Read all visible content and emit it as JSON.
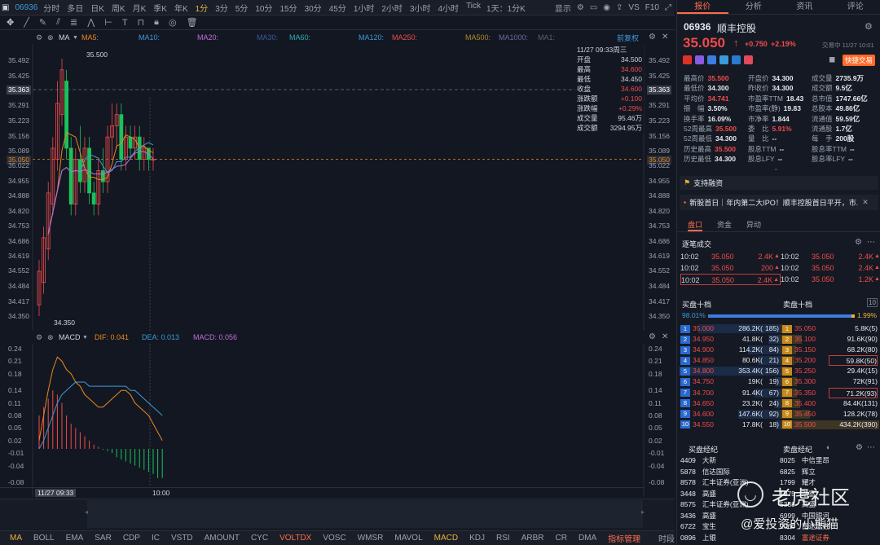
{
  "topbar": {
    "symbol": "06936",
    "periods": [
      "分时",
      "多日",
      "日K",
      "周K",
      "月K",
      "季K",
      "年K",
      "1分",
      "3分",
      "5分",
      "10分",
      "15分",
      "30分",
      "45分",
      "1小时",
      "2小时",
      "3小时",
      "4小时",
      "Tick"
    ],
    "selected": "1分",
    "compare": "1天：1分K",
    "display": "显示",
    "vs": "VS",
    "f10": "F10"
  },
  "legend": {
    "ma_name": "MA",
    "ma5": "MA5:",
    "ma10": "MA10:",
    "ma20": "MA20:",
    "ma30": "MA30:",
    "ma60": "MA60:",
    "ma120": "MA120:",
    "ma250": "MA250:",
    "ma500": "MA500:",
    "ma1000": "MA1000:",
    "ma_more": "MA1:",
    "adjust": "前复权",
    "macd_name": "MACD",
    "dif": "DIF: 0.041",
    "dea": "DEA: 0.013",
    "macd": "MACD: 0.056"
  },
  "chart": {
    "price_ticks": [
      "35.492",
      "35.425",
      "35.363",
      "35.291",
      "35.223",
      "35.156",
      "35.089",
      "35.050",
      "35.022",
      "34.955",
      "34.888",
      "34.820",
      "34.753",
      "34.686",
      "34.619",
      "34.552",
      "34.484",
      "34.417",
      "34.350"
    ],
    "high_label": "35.500",
    "low_label": "34.350",
    "macd_ticks": [
      "0.24",
      "0.21",
      "0.18",
      "0.14",
      "0.11",
      "0.08",
      "0.05",
      "0.02",
      "-0.01",
      "-0.04",
      "-0.08"
    ],
    "time_start": "11/27 09:33",
    "time_mid": "10:00",
    "ohlc": {
      "date": "11/27 09:33周三",
      "rows": [
        {
          "k": "开盘",
          "v": "34.500"
        },
        {
          "k": "最高",
          "v": "34.600"
        },
        {
          "k": "最低",
          "v": "34.450"
        },
        {
          "k": "收盘",
          "v": "34.600"
        },
        {
          "k": "涨跌额",
          "v": "+0.100"
        },
        {
          "k": "涨跌幅",
          "v": "+0.29%"
        },
        {
          "k": "成交量",
          "v": "95.46万"
        },
        {
          "k": "成交额",
          "v": "3294.95万"
        }
      ]
    },
    "colors": {
      "up": "#f04b4b",
      "down": "#19c25b",
      "ma5": "#e8891c",
      "ma10": "#3b9bd8",
      "ma20": "#c070d8"
    }
  },
  "bottombar": {
    "items": [
      "MA",
      "BOLL",
      "EMA",
      "SAR",
      "CDP",
      "IC",
      "VSTD",
      "AMOUNT",
      "CYC",
      "VOLTDX",
      "VOSC",
      "WMSR",
      "MAVOL",
      "MACD",
      "KDJ",
      "RSI",
      "ARBR",
      "CR",
      "DMA",
      "指标管理",
      "时段"
    ],
    "selected": [
      "MA",
      "MACD"
    ]
  },
  "quote": {
    "tabs": [
      "报价",
      "分析",
      "资讯",
      "评论"
    ],
    "code": "06936",
    "name": "顺丰控股",
    "price": "35.050",
    "change": "+0.750",
    "pct": "+2.19%",
    "status": "交易中 11/27 10:01",
    "trade_btn": "快捷交易",
    "stats": [
      [
        [
          "最高价",
          "35.500"
        ],
        [
          "开盘价",
          "34.300"
        ],
        [
          "成交量",
          "2735.9万"
        ]
      ],
      [
        [
          "最低价",
          "34.300"
        ],
        [
          "昨收价",
          "34.300"
        ],
        [
          "成交额",
          "9.5亿"
        ]
      ],
      [
        [
          "平均价",
          "34.741"
        ],
        [
          "市盈率TTM",
          "18.43"
        ],
        [
          "总市值",
          "1747.66亿"
        ]
      ],
      [
        [
          "振　幅",
          "3.50%"
        ],
        [
          "市盈率(静)",
          "19.83"
        ],
        [
          "总股本",
          "49.86亿"
        ]
      ],
      [
        [
          "换手率",
          "16.09%"
        ],
        [
          "市净率",
          "1.844"
        ],
        [
          "流通值",
          "59.59亿"
        ]
      ],
      [
        [
          "52周最高",
          "35.500"
        ],
        [
          "委　比",
          "5.91%"
        ],
        [
          "流通股",
          "1.7亿"
        ]
      ],
      [
        [
          "52周最低",
          "34.300"
        ],
        [
          "量　比",
          "--"
        ],
        [
          "每　手",
          "200股"
        ]
      ],
      [
        [
          "历史最高",
          "35.500"
        ],
        [
          "股息TTM",
          "--"
        ],
        [
          "股息率TTM",
          "--"
        ]
      ],
      [
        [
          "历史最低",
          "34.300"
        ],
        [
          "股息LFY",
          "--"
        ],
        [
          "股息率LFY",
          "--"
        ]
      ]
    ],
    "margin": "支持融资",
    "news": "新股首日｜年内第二大IPO！顺丰控股首日平开，市...",
    "subtabs": [
      "盘口",
      "资金",
      "异动"
    ],
    "ticks_title": "逐笔成交",
    "ticks": [
      [
        [
          "10:02",
          "35.050",
          "2.4K"
        ],
        [
          "10:02",
          "35.050",
          "2.4K"
        ]
      ],
      [
        [
          "10:02",
          "35.050",
          "200"
        ],
        [
          "10:02",
          "35.050",
          "2.4K"
        ]
      ],
      [
        [
          "10:02",
          "35.050",
          "2.4K"
        ],
        [
          "10:02",
          "35.050",
          "1.2K"
        ]
      ]
    ],
    "bid_title": "买盘十档",
    "ask_title": "卖盘十档",
    "bid_pct": "98.01%",
    "ask_pct": "1.99%",
    "levels": [
      {
        "n": "1",
        "bp": "35.000",
        "bv": "286.2K(",
        "bc": "185)",
        "ap": "35.050",
        "av": "5.8K(",
        "ac": "5)"
      },
      {
        "n": "2",
        "bp": "34.950",
        "bv": "41.8K(",
        "bc": "32)",
        "ap": "35.100",
        "av": "91.6K(",
        "ac": "90)"
      },
      {
        "n": "3",
        "bp": "34.900",
        "bv": "114.2K(",
        "bc": "84)",
        "ap": "35.150",
        "av": "68.2K(",
        "ac": "80)"
      },
      {
        "n": "4",
        "bp": "34.850",
        "bv": "80.6K(",
        "bc": "21)",
        "ap": "35.200",
        "av": "59.8K(",
        "ac": "50)"
      },
      {
        "n": "5",
        "bp": "34.800",
        "bv": "353.4K(",
        "bc": "156)",
        "ap": "35.250",
        "av": "29.4K(",
        "ac": "15)"
      },
      {
        "n": "6",
        "bp": "34.750",
        "bv": "19K(",
        "bc": "19)",
        "ap": "35.300",
        "av": "72K(",
        "ac": "91)"
      },
      {
        "n": "7",
        "bp": "34.700",
        "bv": "91.4K(",
        "bc": "67)",
        "ap": "35.350",
        "av": "71.2K(",
        "ac": "93)"
      },
      {
        "n": "8",
        "bp": "34.650",
        "bv": "23.2K(",
        "bc": "24)",
        "ap": "35.400",
        "av": "84.4K(",
        "ac": "131)"
      },
      {
        "n": "9",
        "bp": "34.600",
        "bv": "147.6K(",
        "bc": "92)",
        "ap": "35.450",
        "av": "128.2K(",
        "ac": "78)"
      },
      {
        "n": "10",
        "bp": "34.550",
        "bv": "17.8K(",
        "bc": "18)",
        "ap": "35.500",
        "av": "434.2K(",
        "ac": "390)"
      }
    ],
    "brokers_bid_title": "买盘经纪",
    "brokers_ask_title": "卖盘经纪",
    "brokers": [
      [
        [
          "4409",
          "大新"
        ],
        [
          "8025",
          "中信里昂"
        ]
      ],
      [
        [
          "5878",
          "信达国际"
        ],
        [
          "6825",
          "辉立"
        ]
      ],
      [
        [
          "8578",
          "汇丰证券(亚洲)"
        ],
        [
          "1799",
          "耀才"
        ]
      ],
      [
        [
          "3448",
          "高盛"
        ],
        [
          "1975",
          "瑞富"
        ]
      ],
      [
        [
          "8575",
          "汇丰证券(亚洲)"
        ],
        [
          "5338",
          "高盛"
        ]
      ],
      [
        [
          "3436",
          "高盛"
        ],
        [
          "6999",
          "中国银河"
        ]
      ],
      [
        [
          "6722",
          "宝生"
        ],
        [
          "2066",
          "富途证券"
        ]
      ],
      [
        [
          "0896",
          "上银"
        ],
        [
          "8304",
          "富途证券"
        ]
      ]
    ]
  },
  "watermark": {
    "brand": "老虎社区",
    "user": "@爱投资的小熊猫"
  }
}
